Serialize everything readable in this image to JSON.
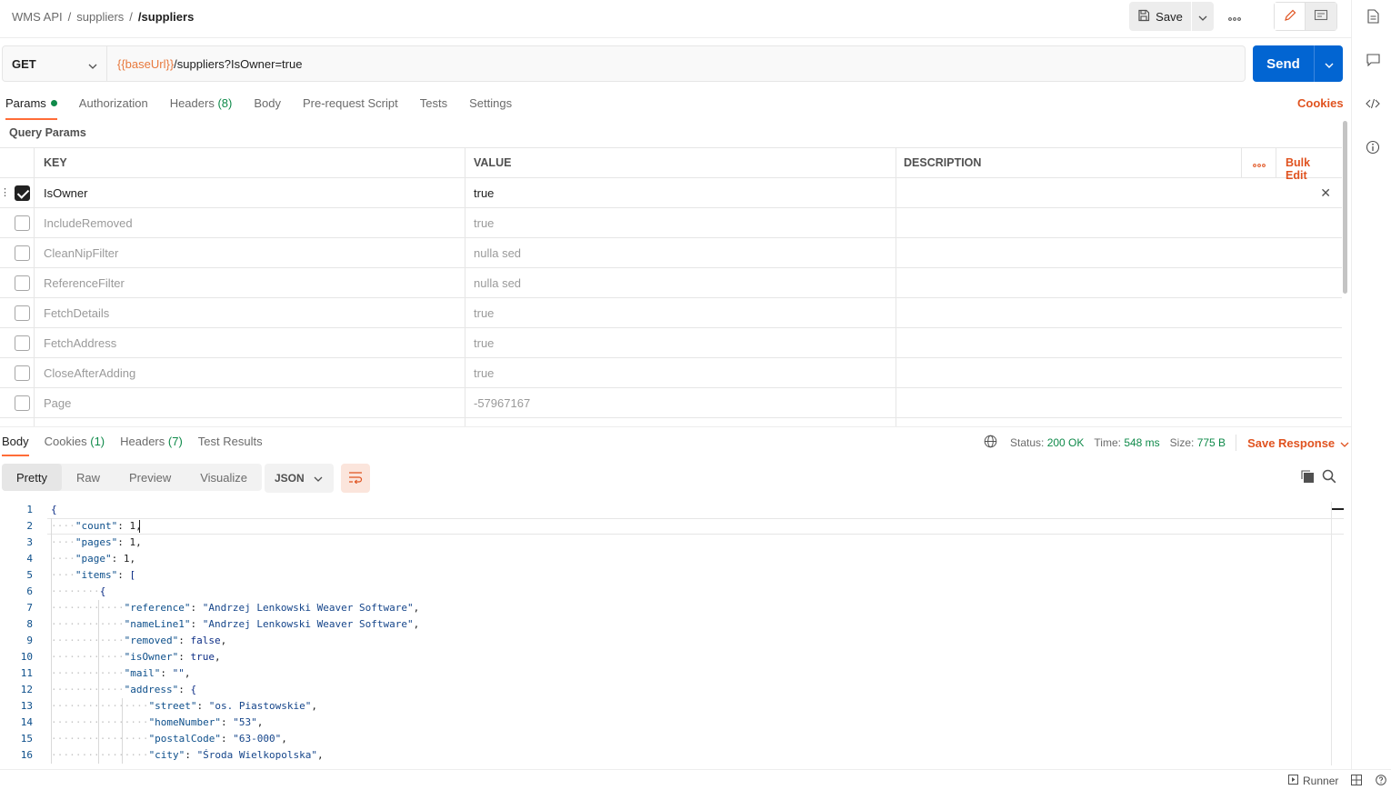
{
  "breadcrumb": {
    "collection": "WMS API",
    "folder": "suppliers",
    "request": "/suppliers",
    "sep": "/"
  },
  "toolbar": {
    "save_label": "Save"
  },
  "request": {
    "method": "GET",
    "url_var": "{{baseUrl}}",
    "url_path": "/suppliers?IsOwner=true",
    "send_label": "Send"
  },
  "request_tabs": [
    {
      "label": "Params",
      "count": ""
    },
    {
      "label": "Authorization",
      "count": ""
    },
    {
      "label": "Headers",
      "count": "(8)"
    },
    {
      "label": "Body",
      "count": ""
    },
    {
      "label": "Pre-request Script",
      "count": ""
    },
    {
      "label": "Tests",
      "count": ""
    },
    {
      "label": "Settings",
      "count": ""
    }
  ],
  "cookies_link": "Cookies",
  "query_params": {
    "title": "Query Params",
    "headers": {
      "key": "KEY",
      "value": "VALUE",
      "description": "DESCRIPTION",
      "bulk_edit": "Bulk Edit"
    },
    "rows": [
      {
        "key": "IsOwner",
        "value": "true",
        "checked": true
      },
      {
        "key": "IncludeRemoved",
        "value": "true",
        "checked": false
      },
      {
        "key": "CleanNipFilter",
        "value": "nulla sed",
        "checked": false
      },
      {
        "key": "ReferenceFilter",
        "value": "nulla sed",
        "checked": false
      },
      {
        "key": "FetchDetails",
        "value": "true",
        "checked": false
      },
      {
        "key": "FetchAddress",
        "value": "true",
        "checked": false
      },
      {
        "key": "CloseAfterAdding",
        "value": "true",
        "checked": false
      },
      {
        "key": "Page",
        "value": "-57967167",
        "checked": false
      }
    ]
  },
  "response_tabs": [
    {
      "label": "Body",
      "count": ""
    },
    {
      "label": "Cookies",
      "count": "(1)"
    },
    {
      "label": "Headers",
      "count": "(7)"
    },
    {
      "label": "Test Results",
      "count": ""
    }
  ],
  "response_meta": {
    "status_label": "Status:",
    "status_value": "200 OK",
    "time_label": "Time:",
    "time_value": "548 ms",
    "size_label": "Size:",
    "size_value": "775 B",
    "save_response": "Save Response"
  },
  "view_tabs": [
    "Pretty",
    "Raw",
    "Preview",
    "Visualize"
  ],
  "format": "JSON",
  "code_lines": [
    {
      "n": "1",
      "indent": 0,
      "parts": [
        [
          "b",
          "{"
        ]
      ]
    },
    {
      "n": "2",
      "indent": 1,
      "parts": [
        [
          "k",
          "\"count\""
        ],
        [
          "n",
          ": "
        ],
        [
          "n",
          "1"
        ],
        [
          "n",
          ","
        ]
      ]
    },
    {
      "n": "3",
      "indent": 1,
      "parts": [
        [
          "k",
          "\"pages\""
        ],
        [
          "n",
          ": "
        ],
        [
          "n",
          "1"
        ],
        [
          "n",
          ","
        ]
      ]
    },
    {
      "n": "4",
      "indent": 1,
      "parts": [
        [
          "k",
          "\"page\""
        ],
        [
          "n",
          ": "
        ],
        [
          "n",
          "1"
        ],
        [
          "n",
          ","
        ]
      ]
    },
    {
      "n": "5",
      "indent": 1,
      "parts": [
        [
          "k",
          "\"items\""
        ],
        [
          "n",
          ": "
        ],
        [
          "b",
          "["
        ]
      ]
    },
    {
      "n": "6",
      "indent": 2,
      "parts": [
        [
          "b",
          "{"
        ]
      ]
    },
    {
      "n": "7",
      "indent": 3,
      "parts": [
        [
          "k",
          "\"reference\""
        ],
        [
          "n",
          ": "
        ],
        [
          "s",
          "\"Andrzej Lenkowski Weaver Software\""
        ],
        [
          "n",
          ","
        ]
      ]
    },
    {
      "n": "8",
      "indent": 3,
      "parts": [
        [
          "k",
          "\"nameLine1\""
        ],
        [
          "n",
          ": "
        ],
        [
          "s",
          "\"Andrzej Lenkowski Weaver Software\""
        ],
        [
          "n",
          ","
        ]
      ]
    },
    {
      "n": "9",
      "indent": 3,
      "parts": [
        [
          "k",
          "\"removed\""
        ],
        [
          "n",
          ": "
        ],
        [
          "b",
          "false"
        ],
        [
          "n",
          ","
        ]
      ]
    },
    {
      "n": "10",
      "indent": 3,
      "parts": [
        [
          "k",
          "\"isOwner\""
        ],
        [
          "n",
          ": "
        ],
        [
          "b",
          "true"
        ],
        [
          "n",
          ","
        ]
      ]
    },
    {
      "n": "11",
      "indent": 3,
      "parts": [
        [
          "k",
          "\"mail\""
        ],
        [
          "n",
          ": "
        ],
        [
          "s",
          "\"\""
        ],
        [
          "n",
          ","
        ]
      ]
    },
    {
      "n": "12",
      "indent": 3,
      "parts": [
        [
          "k",
          "\"address\""
        ],
        [
          "n",
          ": "
        ],
        [
          "b",
          "{"
        ]
      ]
    },
    {
      "n": "13",
      "indent": 4,
      "parts": [
        [
          "k",
          "\"street\""
        ],
        [
          "n",
          ": "
        ],
        [
          "s",
          "\"os. Piastowskie\""
        ],
        [
          "n",
          ","
        ]
      ]
    },
    {
      "n": "14",
      "indent": 4,
      "parts": [
        [
          "k",
          "\"homeNumber\""
        ],
        [
          "n",
          ": "
        ],
        [
          "s",
          "\"53\""
        ],
        [
          "n",
          ","
        ]
      ]
    },
    {
      "n": "15",
      "indent": 4,
      "parts": [
        [
          "k",
          "\"postalCode\""
        ],
        [
          "n",
          ": "
        ],
        [
          "s",
          "\"63-000\""
        ],
        [
          "n",
          ","
        ]
      ]
    },
    {
      "n": "16",
      "indent": 4,
      "parts": [
        [
          "k",
          "\"city\""
        ],
        [
          "n",
          ": "
        ],
        [
          "s",
          "\"Środa Wielkopolska\""
        ],
        [
          "n",
          ","
        ]
      ]
    }
  ],
  "statusbar": {
    "runner": "Runner"
  },
  "colors": {
    "accent": "#ff6c37",
    "send": "#0265d2",
    "success": "#0f8a4a",
    "link": "#e05320"
  }
}
